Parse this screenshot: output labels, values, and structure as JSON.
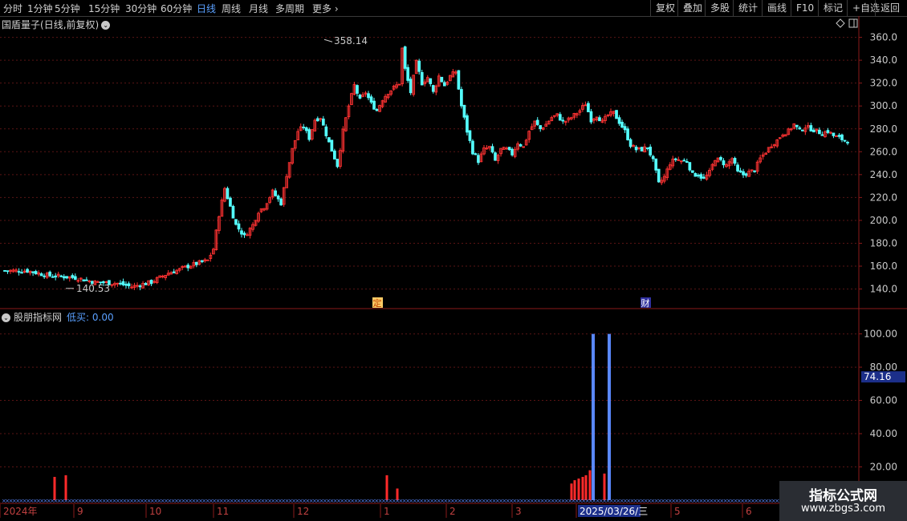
{
  "toolbar": {
    "periods": [
      "分时",
      "1分钟",
      "5分钟",
      "15分钟",
      "30分钟",
      "60分钟",
      "日线",
      "周线",
      "月线",
      "多周期",
      "更多"
    ],
    "active_period": "日线",
    "right_buttons": [
      "复权",
      "叠加",
      "多股",
      "统计",
      "画线",
      "F10",
      "标记",
      "+自选",
      "返回"
    ]
  },
  "main_panel": {
    "stock_name": "国盾量子",
    "mode": "(日线,前复权)",
    "high_label": "358.14",
    "low_label": "140.53",
    "event_markers": [
      "定",
      "财"
    ]
  },
  "indicator_panel": {
    "name": "股朋指标网",
    "line_label": "低买: 0.00",
    "y_value_badge": "74.16"
  },
  "x_axis": {
    "labels": [
      "2024年",
      "9",
      "10",
      "11",
      "12",
      "1",
      "2",
      "3",
      "2025/03/26/三",
      "5",
      "6"
    ]
  },
  "watermark": {
    "line1": "指标公式网",
    "line2": "www.zbgs3.com"
  },
  "chart_data": [
    {
      "type": "candlestick",
      "title": "国盾量子(日线,前复权)",
      "ylim": [
        132,
        366
      ],
      "yticks": [
        140,
        160,
        180,
        200,
        220,
        240,
        260,
        280,
        300,
        320,
        340,
        360
      ],
      "ytick_labels": [
        "140.0",
        "160.0",
        "180.0",
        "200.0",
        "220.0",
        "240.0",
        "260.0",
        "280.0",
        "300.0",
        "320.0",
        "340.0",
        "360.0"
      ],
      "annotations": [
        {
          "text": "358.14",
          "value": 358.14
        },
        {
          "text": "140.53",
          "value": 140.53
        }
      ],
      "colors": {
        "up": "#ff3232",
        "down": "#54ffff"
      },
      "close_path": [
        [
          0,
          156
        ],
        [
          8,
          156
        ],
        [
          15,
          152
        ],
        [
          25,
          150
        ],
        [
          32,
          146
        ],
        [
          40,
          145
        ],
        [
          45,
          142
        ],
        [
          52,
          146
        ],
        [
          58,
          154
        ],
        [
          62,
          157
        ],
        [
          65,
          160
        ],
        [
          72,
          165
        ],
        [
          74,
          175
        ],
        [
          76,
          205
        ],
        [
          78,
          228
        ],
        [
          80,
          212
        ],
        [
          82,
          196
        ],
        [
          85,
          186
        ],
        [
          88,
          196
        ],
        [
          90,
          208
        ],
        [
          92,
          212
        ],
        [
          95,
          225
        ],
        [
          98,
          215
        ],
        [
          100,
          240
        ],
        [
          102,
          262
        ],
        [
          104,
          278
        ],
        [
          106,
          282
        ],
        [
          108,
          272
        ],
        [
          110,
          288
        ],
        [
          112,
          290
        ],
        [
          115,
          268
        ],
        [
          118,
          248
        ],
        [
          120,
          278
        ],
        [
          122,
          300
        ],
        [
          124,
          318
        ],
        [
          126,
          305
        ],
        [
          128,
          312
        ],
        [
          130,
          302
        ],
        [
          132,
          296
        ],
        [
          134,
          306
        ],
        [
          136,
          312
        ],
        [
          140,
          320
        ],
        [
          141,
          350
        ],
        [
          142,
          332
        ],
        [
          144,
          312
        ],
        [
          146,
          338
        ],
        [
          148,
          320
        ],
        [
          150,
          325
        ],
        [
          152,
          312
        ],
        [
          154,
          326
        ],
        [
          156,
          318
        ],
        [
          158,
          326
        ],
        [
          160,
          330
        ],
        [
          162,
          300
        ],
        [
          164,
          278
        ],
        [
          166,
          260
        ],
        [
          168,
          252
        ],
        [
          170,
          262
        ],
        [
          172,
          264
        ],
        [
          174,
          252
        ],
        [
          176,
          262
        ],
        [
          178,
          262
        ],
        [
          180,
          258
        ],
        [
          182,
          268
        ],
        [
          184,
          264
        ],
        [
          186,
          278
        ],
        [
          188,
          286
        ],
        [
          190,
          280
        ],
        [
          192,
          284
        ],
        [
          194,
          290
        ],
        [
          196,
          292
        ],
        [
          198,
          286
        ],
        [
          200,
          288
        ],
        [
          202,
          292
        ],
        [
          204,
          296
        ],
        [
          206,
          302
        ],
        [
          208,
          288
        ],
        [
          210,
          292
        ],
        [
          212,
          286
        ],
        [
          214,
          292
        ],
        [
          216,
          294
        ],
        [
          218,
          286
        ],
        [
          220,
          278
        ],
        [
          222,
          266
        ],
        [
          224,
          262
        ],
        [
          226,
          262
        ],
        [
          228,
          264
        ],
        [
          230,
          252
        ],
        [
          232,
          232
        ],
        [
          234,
          238
        ],
        [
          236,
          250
        ],
        [
          238,
          254
        ],
        [
          240,
          252
        ],
        [
          242,
          252
        ],
        [
          244,
          240
        ],
        [
          246,
          240
        ],
        [
          248,
          236
        ],
        [
          250,
          242
        ],
        [
          252,
          254
        ],
        [
          254,
          252
        ],
        [
          256,
          248
        ],
        [
          258,
          254
        ],
        [
          260,
          242
        ],
        [
          262,
          240
        ],
        [
          264,
          242
        ],
        [
          266,
          244
        ],
        [
          268,
          254
        ],
        [
          270,
          260
        ],
        [
          272,
          266
        ],
        [
          274,
          270
        ],
        [
          276,
          276
        ],
        [
          278,
          278
        ],
        [
          280,
          284
        ],
        [
          282,
          278
        ],
        [
          284,
          282
        ],
        [
          286,
          280
        ],
        [
          288,
          278
        ],
        [
          290,
          276
        ],
        [
          292,
          278
        ],
        [
          294,
          274
        ],
        [
          296,
          272
        ],
        [
          298,
          270
        ]
      ]
    },
    {
      "type": "bar",
      "title": "股朋指标网",
      "ylim": [
        0,
        108
      ],
      "yticks": [
        20,
        40,
        60,
        80,
        100
      ],
      "ytick_labels": [
        "20.00",
        "40.00",
        "60.00",
        "80.00",
        "100.00"
      ],
      "series": [
        {
          "name": "低买",
          "color": "#ff2a2a",
          "points": [
            [
              0.4,
              14
            ],
            [
              0.41,
              15
            ],
            [
              0.43,
              15
            ],
            [
              0.73,
              7
            ],
            [
              0.75,
              10
            ],
            [
              0.76,
              12
            ],
            [
              0.77,
              13
            ],
            [
              0.78,
              14
            ],
            [
              0.79,
              15
            ],
            [
              0.81,
              18
            ],
            [
              0.83,
              16
            ]
          ]
        },
        {
          "color": "#5a88ff",
          "points": [
            [
              0.8,
              100
            ],
            [
              0.82,
              100
            ]
          ]
        }
      ]
    }
  ]
}
